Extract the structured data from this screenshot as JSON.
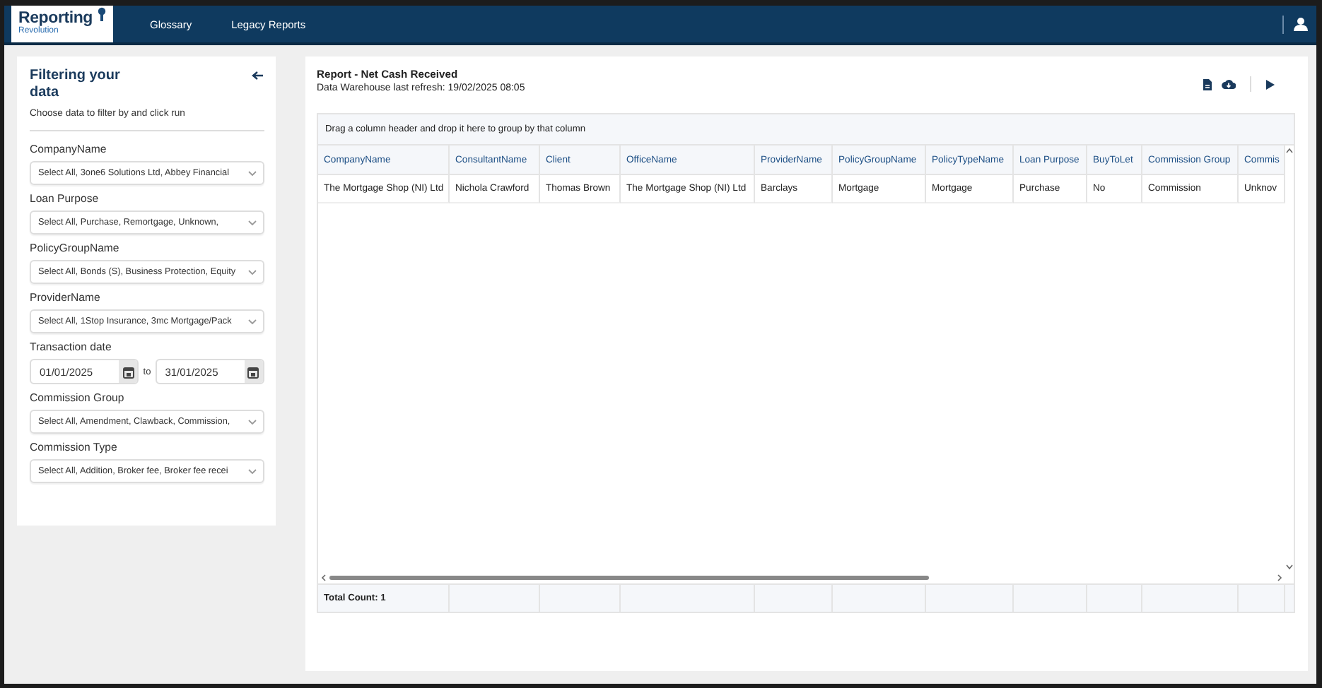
{
  "app": {
    "logo_title": "Reporting",
    "logo_subtitle": "Revolution"
  },
  "nav": [
    {
      "label": "Glossary"
    },
    {
      "label": "Legacy Reports"
    }
  ],
  "filter_panel": {
    "title": "Filtering your data",
    "subtitle": "Choose data to filter by and click run",
    "filters": [
      {
        "kind": "select",
        "label": "CompanyName",
        "value": "Select All, 3one6 Solutions Ltd, Abbey Financial"
      },
      {
        "kind": "select",
        "label": "Loan Purpose",
        "value": "Select All, Purchase, Remortgage, Unknown,"
      },
      {
        "kind": "select",
        "label": "PolicyGroupName",
        "value": "Select All, Bonds (S), Business Protection, Equity"
      },
      {
        "kind": "select",
        "label": "ProviderName",
        "value": "Select All, 1Stop Insurance, 3mc Mortgage/Pack"
      },
      {
        "kind": "daterange",
        "label": "Transaction date",
        "from": "01/01/2025",
        "separator": "to",
        "to": "31/01/2025"
      },
      {
        "kind": "select",
        "label": "Commission Group",
        "value": "Select All, Amendment, Clawback, Commission,"
      },
      {
        "kind": "select",
        "label": "Commission Type",
        "value": "Select All, Addition, Broker fee, Broker fee recei"
      }
    ]
  },
  "report": {
    "title": "Report - Net Cash Received",
    "refresh": "Data Warehouse last refresh: 19/02/2025 08:05",
    "group_hint": "Drag a column header and drop it here to group by that column",
    "table": {
      "columns": [
        "CompanyName",
        "ConsultantName",
        "Client",
        "OfficeName",
        "ProviderName",
        "PolicyGroupName",
        "PolicyTypeName",
        "Loan Purpose",
        "BuyToLet",
        "Commission Group",
        "Commis"
      ],
      "rows": [
        [
          "The Mortgage Shop (NI) Ltd",
          "Nichola Crawford",
          "Thomas Brown",
          "The Mortgage Shop (NI) Ltd",
          "Barclays",
          "Mortgage",
          "Mortgage",
          "Purchase",
          "No",
          "Commission",
          "Unknov"
        ]
      ],
      "footer": "Total Count: 1"
    }
  }
}
